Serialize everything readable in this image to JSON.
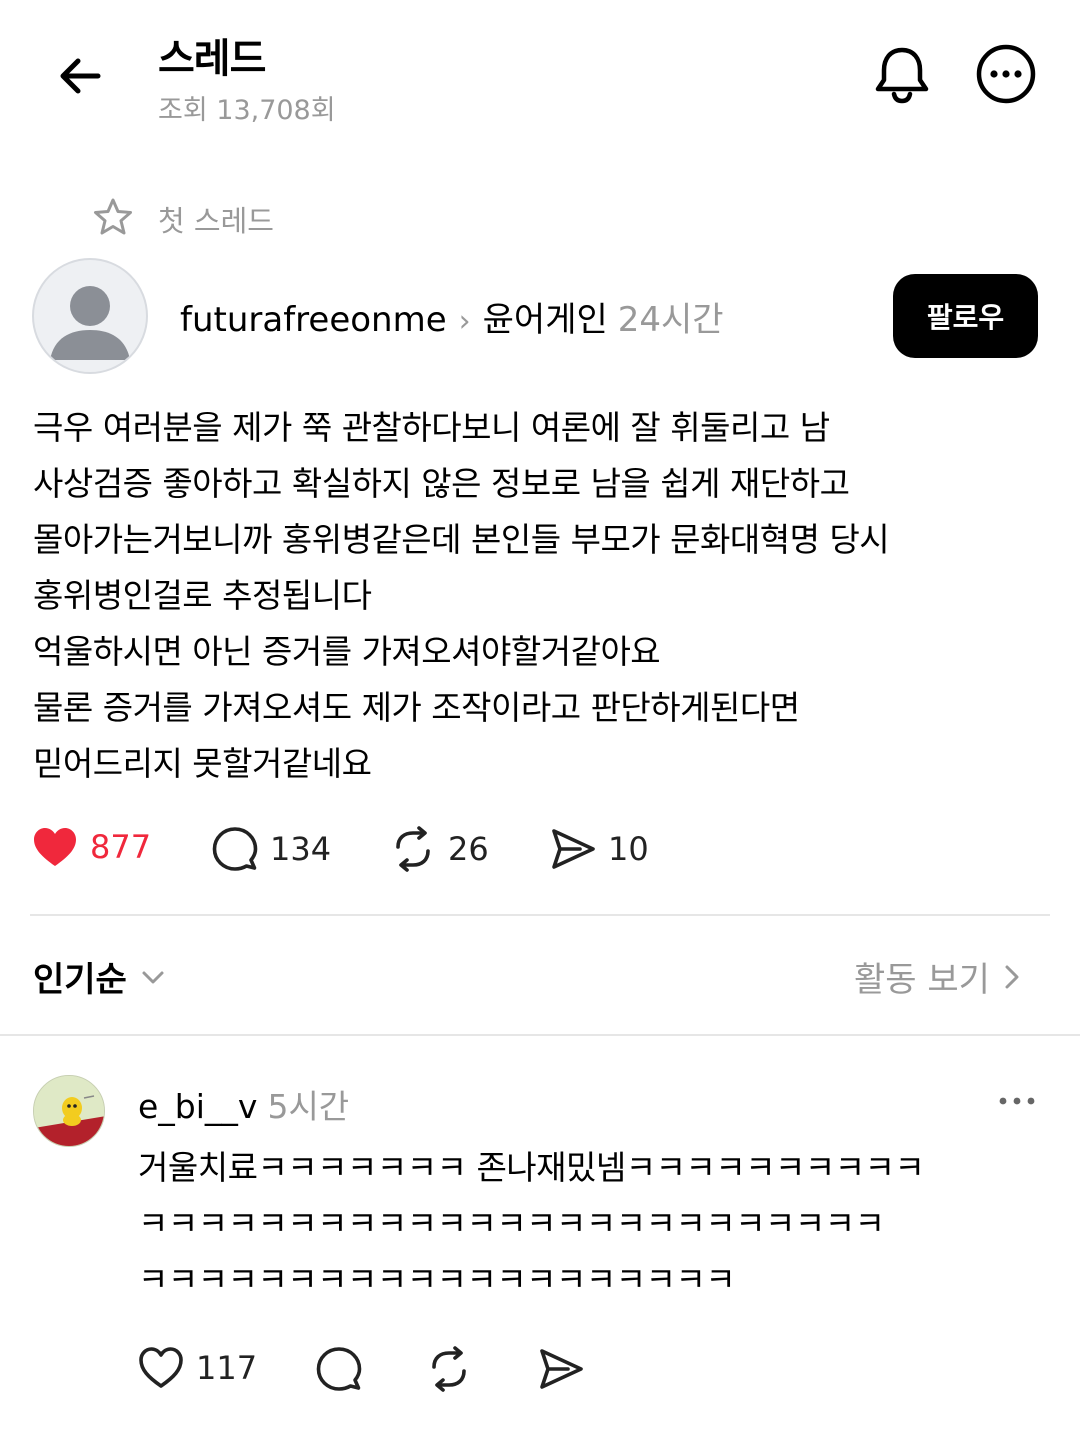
{
  "header": {
    "title": "스레드",
    "views": "조회 13,708회"
  },
  "pinned": {
    "label": "첫 스레드"
  },
  "post": {
    "author": "futurafreeonme",
    "community": "윤어게인",
    "time": "24시간",
    "follow_label": "팔로우",
    "body_lines": [
      "극우 여러분을 제가 쭉 관찰하다보니 여론에 잘 휘둘리고 남",
      "사상검증 좋아하고 확실하지 않은 정보로 남을 쉽게 재단하고",
      "몰아가는거보니까 홍위병같은데 본인들 부모가 문화대혁명 당시",
      "홍위병인걸로 추정됩니다",
      "억울하시면 아닌 증거를 가져오셔야할거같아요",
      "물론 증거를 가져오셔도 제가 조작이라고 판단하게된다면",
      "믿어드리지 못할거같네요"
    ],
    "likes": "877",
    "replies": "134",
    "reposts": "26",
    "shares": "10"
  },
  "sort": {
    "label": "인기순",
    "activity_label": "활동 보기"
  },
  "comment": {
    "author": "e_bi__v",
    "time": "5시간",
    "body_lines": [
      "거울치료ㅋㅋㅋㅋㅋㅋㅋ 존나재밌넴ㅋㅋㅋㅋㅋㅋㅋㅋㅋㅋ",
      "ㅋㅋㅋㅋㅋㅋㅋㅋㅋㅋㅋㅋㅋㅋㅋㅋㅋㅋㅋㅋㅋㅋㅋㅋㅋ",
      "ㅋㅋㅋㅋㅋㅋㅋㅋㅋㅋㅋㅋㅋㅋㅋㅋㅋㅋㅋㅋ"
    ],
    "likes": "117"
  },
  "colors": {
    "like_red": "#f0283c",
    "muted": "#999999",
    "divider": "#e6e6e6"
  },
  "icons": {
    "back": "arrow-left-icon",
    "bell": "bell-icon",
    "more": "more-circle-icon",
    "star": "star-icon",
    "like": "heart-filled-icon",
    "reply": "speech-bubble-icon",
    "repost": "repost-icon",
    "share": "send-icon"
  }
}
